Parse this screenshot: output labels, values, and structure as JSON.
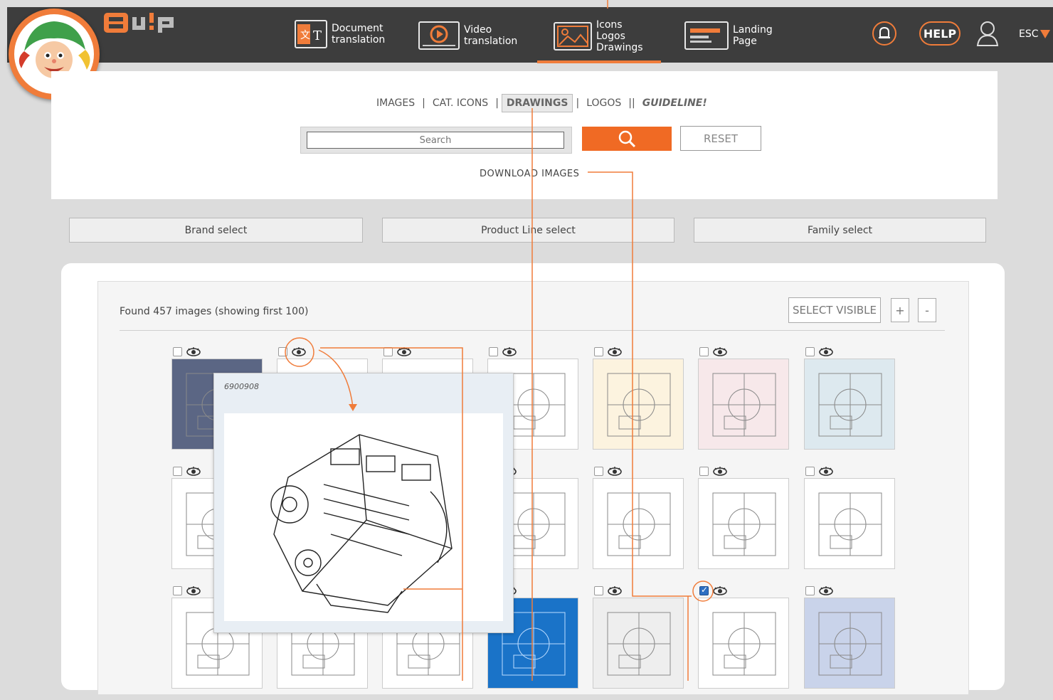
{
  "nav": {
    "items": [
      {
        "label": "Document\ntranslation"
      },
      {
        "label": "Video\ntranslation"
      },
      {
        "label": "Icons\nLogos\nDrawings"
      },
      {
        "label": "Landing\nPage"
      }
    ],
    "help": "HELP",
    "esc": "ESC"
  },
  "tabs": {
    "images": "IMAGES",
    "cat_icons": "CAT. ICONS",
    "drawings": "DRAWINGS",
    "logos": "LOGOS",
    "guideline": "GUIDELINE!"
  },
  "search": {
    "placeholder": "Search",
    "reset": "RESET",
    "download": "DOWNLOAD IMAGES"
  },
  "selects": {
    "brand": "Brand select",
    "product_line": "Product Line select",
    "family": "Family select"
  },
  "results": {
    "found": "Found 457 images (showing first 100)",
    "select_visible": "SELECT VISIBLE",
    "plus": "+",
    "minus": "-",
    "popup_code": "6900908"
  },
  "colors": {
    "accent": "#f07c3a",
    "topbar": "#3d3d3d",
    "check": "#2d6fc2"
  }
}
